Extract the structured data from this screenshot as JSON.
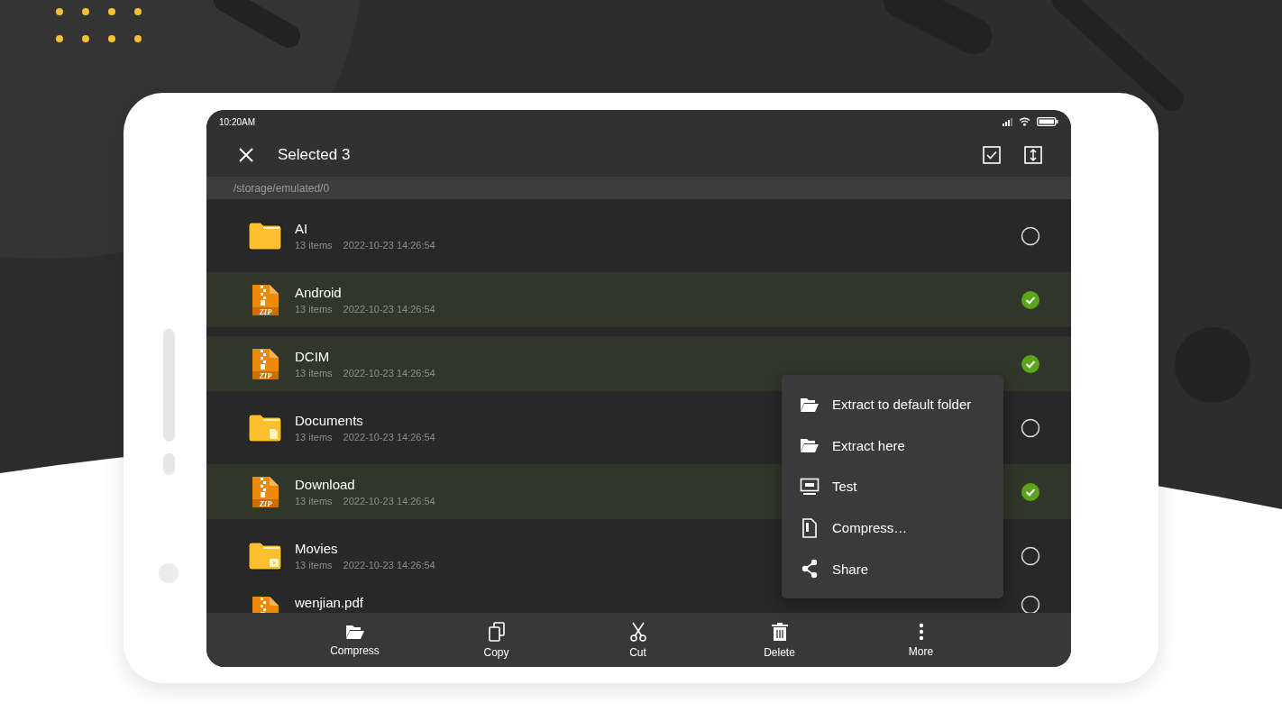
{
  "status_bar": {
    "time": "10:20AM"
  },
  "toolbar": {
    "title": "Selected 3"
  },
  "path": "/storage/emulated/0",
  "files": [
    {
      "name": "AI",
      "kind": "folder",
      "count": "13 items",
      "date": "2022-10-23 14:26:54",
      "selected": false
    },
    {
      "name": "Android",
      "kind": "archive",
      "badge": "ZIP",
      "count": "13 items",
      "date": "2022-10-23 14:26:54",
      "selected": true
    },
    {
      "name": "DCIM",
      "kind": "archive",
      "badge": "ZIP",
      "count": "13 items",
      "date": "2022-10-23 14:26:54",
      "selected": true
    },
    {
      "name": "Documents",
      "kind": "docs_folder",
      "count": "13 items",
      "date": "2022-10-23 14:26:54",
      "selected": false
    },
    {
      "name": "Download",
      "kind": "archive",
      "badge": "ZIP",
      "count": "13 items",
      "date": "2022-10-23 14:26:54",
      "selected": true
    },
    {
      "name": "Movies",
      "kind": "video_folder",
      "count": "13 items",
      "date": "2022-10-23 14:26:54",
      "selected": false
    },
    {
      "name": "wenjian.pdf",
      "kind": "archive",
      "selected": false
    }
  ],
  "menu": [
    {
      "kind": "extract",
      "label": "Extract to default folder"
    },
    {
      "kind": "extract",
      "label": "Extract here"
    },
    {
      "kind": "test",
      "label": "Test"
    },
    {
      "kind": "compress",
      "label": "Compress…"
    },
    {
      "kind": "share",
      "label": "Share"
    }
  ],
  "bottom_bar": [
    {
      "kind": "compress",
      "label": "Compress"
    },
    {
      "kind": "copy",
      "label": "Copy"
    },
    {
      "kind": "cut",
      "label": "Cut"
    },
    {
      "kind": "delete",
      "label": "Delete"
    },
    {
      "kind": "more",
      "label": "More"
    }
  ]
}
